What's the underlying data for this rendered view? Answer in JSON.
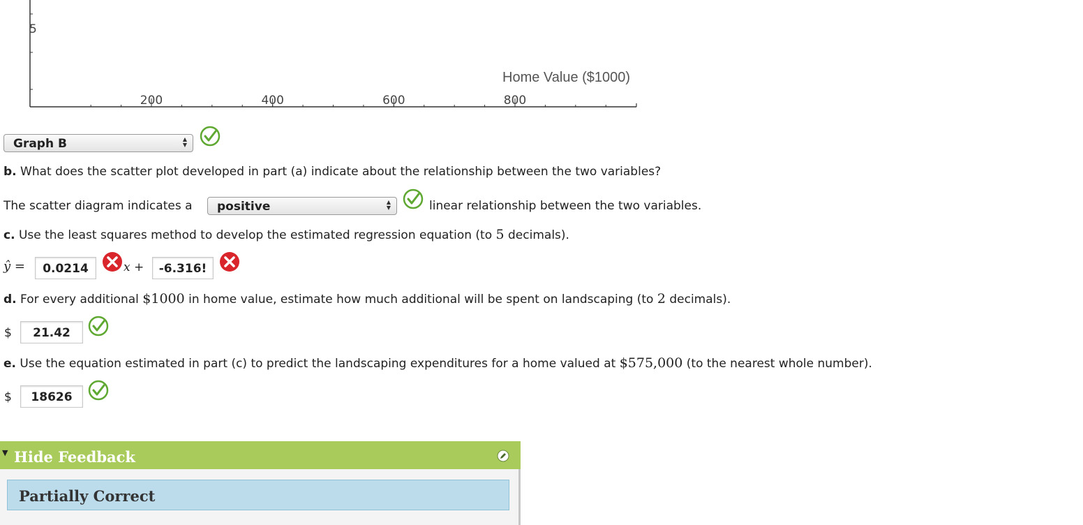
{
  "chart_data": {
    "type": "scatter",
    "xlabel": "Home Value ($1000)",
    "x_ticks": [
      200,
      400,
      600,
      800
    ],
    "y_ticks_visible": [
      5
    ],
    "points": []
  },
  "part_a": {
    "graph_select": "Graph B",
    "status_icon": "check-icon"
  },
  "part_b": {
    "label": "b.",
    "question": "What does the scatter plot developed in part (a) indicate about the relationship between the two variables?",
    "answer_prefix": "The scatter diagram indicates a",
    "answer_select": "positive",
    "answer_suffix": "linear relationship between the two variables.",
    "status_icon": "check-icon"
  },
  "part_c": {
    "label": "c.",
    "question_pre": "Use the least squares method to develop the estimated regression equation (to",
    "decimals": "5",
    "question_post": "decimals).",
    "yhat": "ŷ =",
    "slope_value": "0.0214",
    "x_term": "x +",
    "intercept_value": "-6.316!",
    "slope_status_icon": "x-icon",
    "intercept_status_icon": "x-icon"
  },
  "part_d": {
    "label": "d.",
    "question_pre": "For every additional",
    "amount": "$1000",
    "question_mid": "in home value, estimate how much additional will be spent on landscaping (to",
    "decimals": "2",
    "question_post": "decimals).",
    "currency": "$",
    "answer_value": "21.42",
    "status_icon": "check-icon"
  },
  "part_e": {
    "label": "e.",
    "question_pre": "Use the equation estimated in part (c) to predict the landscaping expenditures for a home valued at",
    "amount": "$575,000",
    "question_post": "(to the nearest whole number).",
    "currency": "$",
    "answer_value": "18626",
    "status_icon": "check-icon"
  },
  "feedback": {
    "toggle_label": "Hide Feedback",
    "status_text": "Partially Correct"
  },
  "colors": {
    "correct": "#5fa831",
    "incorrect": "#d9262c",
    "feedback_header": "#a8cb5c",
    "feedback_body": "#bcdcec"
  }
}
